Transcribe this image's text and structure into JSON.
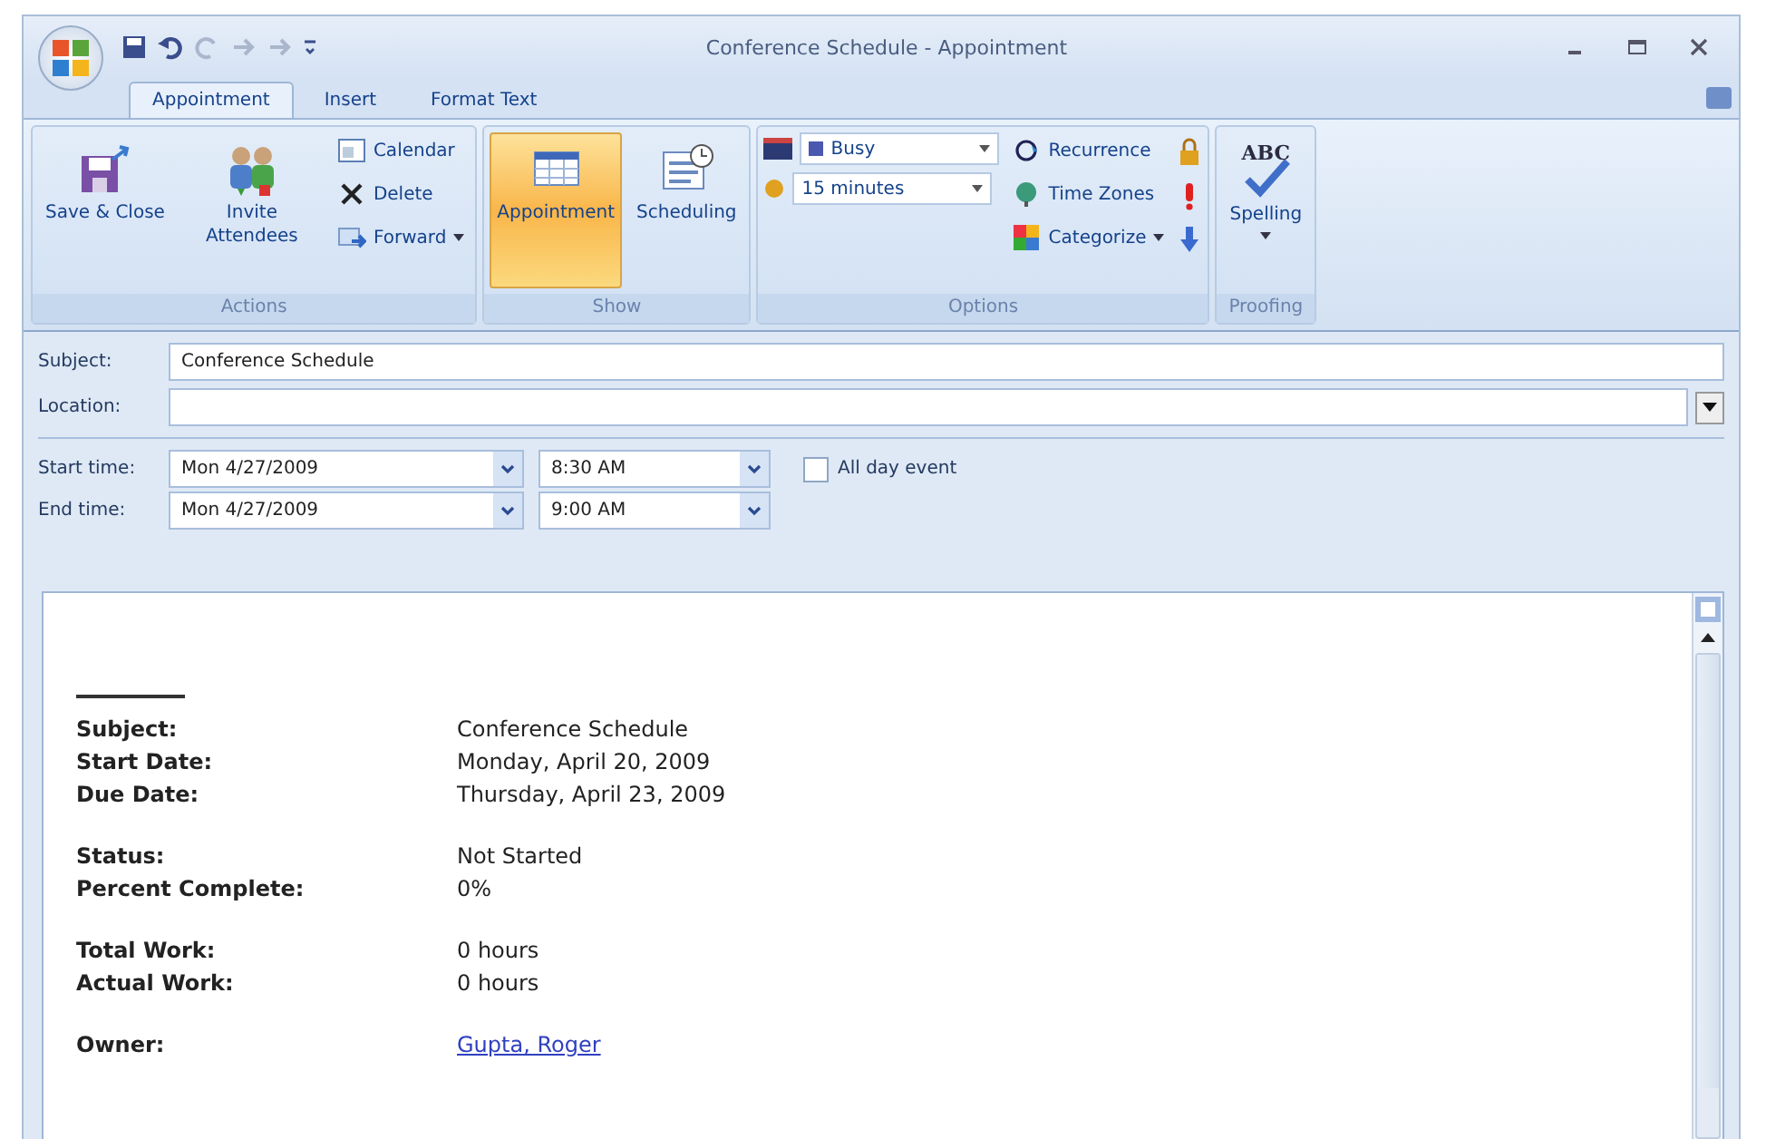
{
  "window": {
    "title": "Conference Schedule - Appointment"
  },
  "tabs": [
    {
      "label": "Appointment",
      "selected": true
    },
    {
      "label": "Insert",
      "selected": false
    },
    {
      "label": "Format Text",
      "selected": false
    }
  ],
  "ribbon": {
    "groups": [
      {
        "label": "Actions",
        "items": [
          {
            "kind": "large",
            "label": "Save & Close",
            "selected": false
          },
          {
            "kind": "large",
            "label": "Invite Attendees",
            "selected": false
          },
          {
            "kind": "stack",
            "items": [
              {
                "label": "Calendar",
                "dropdown": false
              },
              {
                "label": "Delete",
                "dropdown": false
              },
              {
                "label": "Forward",
                "dropdown": true
              }
            ]
          }
        ]
      },
      {
        "label": "Show",
        "items": [
          {
            "kind": "large",
            "label": "Appointment",
            "selected": true
          },
          {
            "kind": "large",
            "label": "Scheduling",
            "selected": false
          }
        ]
      },
      {
        "label": "Options",
        "items": [
          {
            "kind": "combos",
            "items": [
              {
                "value": "Busy"
              },
              {
                "value": "15 minutes"
              }
            ]
          },
          {
            "kind": "stack",
            "items": [
              {
                "label": "Recurrence",
                "dropdown": false
              },
              {
                "label": "Time Zones",
                "dropdown": false
              },
              {
                "label": "Categorize",
                "dropdown": true
              }
            ]
          },
          {
            "kind": "icons"
          }
        ]
      },
      {
        "label": "Proofing",
        "items": [
          {
            "kind": "large",
            "icon_text": "ABC",
            "label": "Spelling",
            "selected": false,
            "dropdown": true
          }
        ]
      }
    ]
  },
  "form": {
    "subject": {
      "label": "Subject:",
      "value": "Conference Schedule"
    },
    "location": {
      "label": "Location:"
    },
    "times": [
      {
        "label": "Start time:",
        "date": "Mon 4/27/2009",
        "time": "8:30 AM"
      },
      {
        "label": "End time:",
        "date": "Mon 4/27/2009",
        "time": "9:00 AM"
      }
    ],
    "all_day": {
      "label": "All day event",
      "checked": false
    }
  },
  "body": {
    "sections": [
      {
        "rows": [
          {
            "label": "Subject:",
            "value": "Conference Schedule",
            "kind": "text"
          },
          {
            "label": "Start Date:",
            "value": "Monday, April 20, 2009",
            "kind": "text"
          },
          {
            "label": "Due Date:",
            "value": "Thursday, April 23, 2009",
            "kind": "text"
          }
        ]
      },
      {
        "rows": [
          {
            "label": "Status:",
            "value": "Not Started",
            "kind": "text"
          },
          {
            "label": "Percent Complete:",
            "value": "0%",
            "kind": "text"
          }
        ]
      },
      {
        "rows": [
          {
            "label": "Total Work:",
            "value": "0 hours",
            "kind": "text"
          },
          {
            "label": "Actual Work:",
            "value": "0 hours",
            "kind": "text"
          }
        ]
      },
      {
        "rows": [
          {
            "label": "Owner:",
            "value": "Gupta, Roger",
            "kind": "link"
          }
        ]
      }
    ]
  }
}
